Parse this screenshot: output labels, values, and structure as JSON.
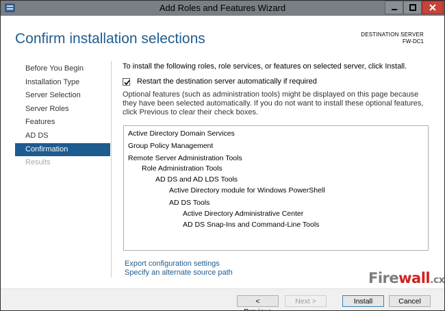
{
  "window": {
    "title": "Add Roles and Features Wizard"
  },
  "header": {
    "title": "Confirm installation selections",
    "destination_label": "DESTINATION SERVER",
    "destination_server": "FW-DC1"
  },
  "nav": {
    "items": [
      {
        "label": "Before You Begin",
        "state": "normal"
      },
      {
        "label": "Installation Type",
        "state": "normal"
      },
      {
        "label": "Server Selection",
        "state": "normal"
      },
      {
        "label": "Server Roles",
        "state": "normal"
      },
      {
        "label": "Features",
        "state": "normal"
      },
      {
        "label": "AD DS",
        "state": "normal"
      },
      {
        "label": "Confirmation",
        "state": "active"
      },
      {
        "label": "Results",
        "state": "disabled"
      }
    ]
  },
  "content": {
    "intro": "To install the following roles, role services, or features on selected server, click Install.",
    "restart_label": "Restart the destination server automatically if required",
    "restart_checked": true,
    "optional_text": "Optional features (such as administration tools) might be displayed on this page because they have been selected automatically. If you do not want to install these optional features, click Previous to clear their check boxes.",
    "tree": [
      {
        "label": "Active Directory Domain Services",
        "level": 0
      },
      {
        "label": "Group Policy Management",
        "level": 0
      },
      {
        "label": "Remote Server Administration Tools",
        "level": 0
      },
      {
        "label": "Role Administration Tools",
        "level": 1
      },
      {
        "label": "AD DS and AD LDS Tools",
        "level": 2
      },
      {
        "label": "Active Directory module for Windows PowerShell",
        "level": 3
      },
      {
        "label": "AD DS Tools",
        "level": 3
      },
      {
        "label": "Active Directory Administrative Center",
        "level": 4
      },
      {
        "label": "AD DS Snap-Ins and Command-Line Tools",
        "level": 4
      }
    ],
    "links": {
      "export": "Export configuration settings",
      "alternate_source": "Specify an alternate source path"
    }
  },
  "watermark": {
    "part1": "Fire",
    "part2": "wall",
    "part3": ".cx"
  },
  "footer": {
    "previous": "< Previous",
    "next": "Next >",
    "install": "Install",
    "cancel": "Cancel"
  },
  "colors": {
    "accent": "#1e5b8f",
    "titlebar": "#7a7f86",
    "close_button": "#c7433a"
  }
}
